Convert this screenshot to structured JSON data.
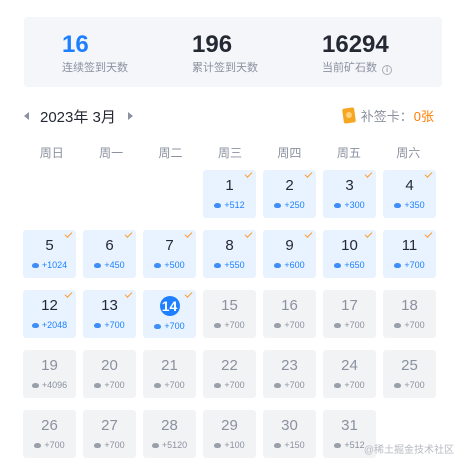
{
  "stats": {
    "continuous_days": "16",
    "continuous_label": "连续签到天数",
    "total_days": "196",
    "total_label": "累计签到天数",
    "ore": "16294",
    "ore_label": "当前矿石数",
    "info_glyph": "i"
  },
  "calendar": {
    "month_title": "2023年 3月",
    "makeup_label": "补签卡：",
    "makeup_count": "0张",
    "weekdays": [
      "周日",
      "周一",
      "周二",
      "周三",
      "周四",
      "周五",
      "周六"
    ],
    "days": [
      {
        "day": "1",
        "reward": "+512",
        "signed": true
      },
      {
        "day": "2",
        "reward": "+250",
        "signed": true
      },
      {
        "day": "3",
        "reward": "+300",
        "signed": true
      },
      {
        "day": "4",
        "reward": "+350",
        "signed": true
      },
      {
        "day": "5",
        "reward": "+1024",
        "signed": true
      },
      {
        "day": "6",
        "reward": "+450",
        "signed": true
      },
      {
        "day": "7",
        "reward": "+500",
        "signed": true
      },
      {
        "day": "8",
        "reward": "+550",
        "signed": true
      },
      {
        "day": "9",
        "reward": "+600",
        "signed": true
      },
      {
        "day": "10",
        "reward": "+650",
        "signed": true
      },
      {
        "day": "11",
        "reward": "+700",
        "signed": true
      },
      {
        "day": "12",
        "reward": "+2048",
        "signed": true
      },
      {
        "day": "13",
        "reward": "+700",
        "signed": true
      },
      {
        "day": "14",
        "reward": "+700",
        "signed": true,
        "today": true
      },
      {
        "day": "15",
        "reward": "+700",
        "signed": false
      },
      {
        "day": "16",
        "reward": "+700",
        "signed": false
      },
      {
        "day": "17",
        "reward": "+700",
        "signed": false
      },
      {
        "day": "18",
        "reward": "+700",
        "signed": false
      },
      {
        "day": "19",
        "reward": "+4096",
        "signed": false
      },
      {
        "day": "20",
        "reward": "+700",
        "signed": false
      },
      {
        "day": "21",
        "reward": "+700",
        "signed": false
      },
      {
        "day": "22",
        "reward": "+700",
        "signed": false
      },
      {
        "day": "23",
        "reward": "+700",
        "signed": false
      },
      {
        "day": "24",
        "reward": "+700",
        "signed": false
      },
      {
        "day": "25",
        "reward": "+700",
        "signed": false
      },
      {
        "day": "26",
        "reward": "+700",
        "signed": false
      },
      {
        "day": "27",
        "reward": "+700",
        "signed": false
      },
      {
        "day": "28",
        "reward": "+5120",
        "signed": false
      },
      {
        "day": "29",
        "reward": "+100",
        "signed": false
      },
      {
        "day": "30",
        "reward": "+150",
        "signed": false
      },
      {
        "day": "31",
        "reward": "+512",
        "signed": false
      }
    ],
    "first_weekday": 3
  },
  "watermark": "@稀土掘金技术社区",
  "colors": {
    "accent": "#1e80ff",
    "signed_bg": "#e8f3ff",
    "unsigned_bg": "#f2f3f5",
    "check": "#ff9a2e"
  }
}
